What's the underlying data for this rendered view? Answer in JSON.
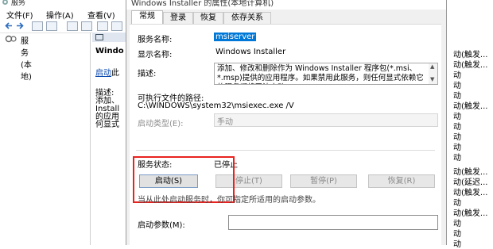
{
  "bg_window": {
    "title": "服务",
    "menu": [
      "文件(F)",
      "操作(A)",
      "查看(V)"
    ],
    "tree_root": "服务(本地)",
    "detail_heading": "Windo",
    "detail_link": "启动",
    "detail_link_suffix": "此",
    "detail_desc_lines": [
      "描述:",
      "添加、",
      "Install",
      "的应用",
      "何显式"
    ],
    "right_strip": [
      "动(触发...",
      "动(触发...",
      "动",
      "动",
      "动",
      "动(触发...",
      "动",
      "动",
      "动",
      "动",
      "动",
      "动(触发...",
      "动(延迟...",
      "动(触发...",
      "动",
      "动(触发...",
      "动",
      "动",
      "动",
      "动",
      "动(触发..."
    ]
  },
  "dialog": {
    "title": "Windows Installer 的属性(本地计算机)",
    "tabs": [
      "常规",
      "登录",
      "恢复",
      "依存关系"
    ],
    "active_tab": "常规",
    "service_name_label": "服务名称:",
    "service_name": "msiserver",
    "display_name_label": "显示名称:",
    "display_name": "Windows Installer",
    "description_label": "描述:",
    "description": "添加、修改和删除作为 Windows Installer 程序包(*.msi、*.msp)提供的应用程序。如果禁用此服务，则任何显式依赖它的服务都将无法启动。",
    "exe_path_label": "可执行文件的路径:",
    "exe_path": "C:\\WINDOWS\\system32\\msiexec.exe /V",
    "startup_type_label": "启动类型(E):",
    "startup_type": "手动",
    "status_label": "服务状态:",
    "status": "已停止",
    "buttons": [
      "启动(S)",
      "停止(T)",
      "暂停(P)",
      "恢复(R)"
    ],
    "hint": "当从此处启动服务时，你可指定所适用的启动参数。",
    "params_label": "启动参数(M):",
    "params_value": ""
  },
  "colors": {
    "highlight": "#e8231f",
    "selection": "#0078d7"
  }
}
